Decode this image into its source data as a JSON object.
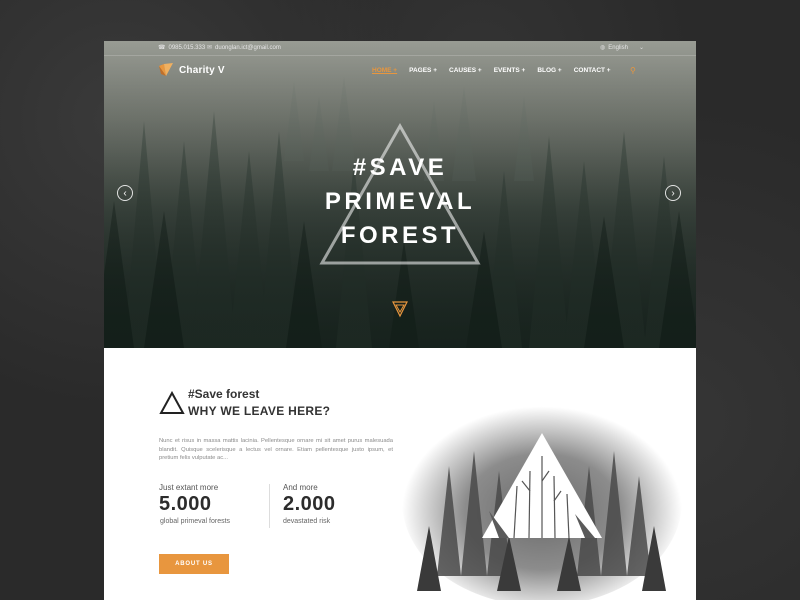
{
  "topbar": {
    "phone": "0985.015.333",
    "email": "duonglan.ict@gmail.com",
    "language": "English"
  },
  "brand": {
    "name": "Charity V"
  },
  "nav": {
    "items": [
      {
        "label": "HOME +",
        "active": true
      },
      {
        "label": "PAGES +",
        "active": false
      },
      {
        "label": "CAUSES +",
        "active": false
      },
      {
        "label": "EVENTS +",
        "active": false
      },
      {
        "label": "BLOG +",
        "active": false
      },
      {
        "label": "CONTACT +",
        "active": false
      }
    ]
  },
  "hero": {
    "line1": "#SAVE",
    "line2": "PRIMEVAL",
    "line3": "FOREST",
    "prev_arrow": "‹",
    "next_arrow": "›"
  },
  "about": {
    "heading_small": "#Save forest",
    "heading_big": "WHY WE LEAVE HERE?",
    "paragraph": "Nunc et risus in massa mattis lacinia. Pellentesque ornare mi sit amet purus malesuada blandit. Quisque scelerisque a lectus vel ornare. Etiam pellentesque justo ipsum, et pretium felis vulputate ac...",
    "stat1": {
      "label": "Just extant more",
      "value": "5.000",
      "sub": "global primeval forests"
    },
    "stat2": {
      "label": "And more",
      "value": "2.000",
      "sub": "devastated risk"
    },
    "button": "ABOUT US"
  },
  "icons": {
    "phone": "phone-icon",
    "email": "mail-icon",
    "globe": "globe-icon",
    "search": "search-icon"
  },
  "colors": {
    "accent": "#e8963e",
    "dark": "#2a2a2a"
  }
}
